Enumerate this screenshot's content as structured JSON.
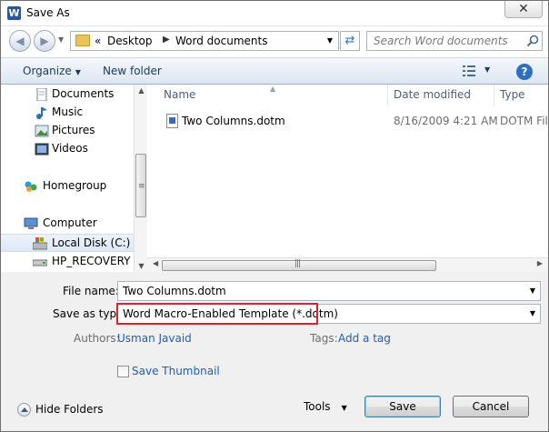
{
  "window": {
    "title": "Save As",
    "app_icon_letter": "W",
    "close_glyph": "✕"
  },
  "address_bar": {
    "prefix": "«",
    "crumbs": [
      "Desktop",
      "Word documents"
    ],
    "separator": "▶",
    "search_placeholder": "Search Word documents"
  },
  "command_bar": {
    "organize_label": "Organize",
    "new_folder_label": "New folder",
    "help_glyph": "?"
  },
  "nav_pane": {
    "items": [
      {
        "label": "Documents",
        "icon": "documents-icon"
      },
      {
        "label": "Music",
        "icon": "music-icon"
      },
      {
        "label": "Pictures",
        "icon": "pictures-icon"
      },
      {
        "label": "Videos",
        "icon": "videos-icon"
      },
      {
        "label": "Homegroup",
        "icon": "homegroup-icon"
      },
      {
        "label": "Computer",
        "icon": "computer-icon"
      },
      {
        "label": "Local Disk (C:)",
        "icon": "local-disk-icon",
        "selected": true
      },
      {
        "label": "HP_RECOVERY (I",
        "icon": "drive-icon"
      }
    ]
  },
  "file_list": {
    "columns": [
      "Name",
      "Date modified",
      "Type"
    ],
    "rows": [
      {
        "name": "Two Columns.dotm",
        "date_modified": "8/16/2009 4:21 AM",
        "type": "DOTM Fil"
      }
    ]
  },
  "form": {
    "file_name_label": "File name:",
    "file_name_value": "Two Columns.dotm",
    "save_as_type_label": "Save as type:",
    "save_as_type_value": "Word Macro-Enabled Template (*.dotm)",
    "authors_label": "Authors:",
    "authors_value": "Usman Javaid",
    "tags_label": "Tags:",
    "tags_value": "Add a tag",
    "save_thumbnail_label": "Save Thumbnail",
    "save_thumbnail_checked": false
  },
  "footer": {
    "hide_folders_label": "Hide Folders",
    "tools_label": "Tools",
    "save_label": "Save",
    "cancel_label": "Cancel"
  },
  "colors": {
    "highlight": "#e0202a",
    "link": "#1e5eb8",
    "accent": "#2d6fc4"
  }
}
